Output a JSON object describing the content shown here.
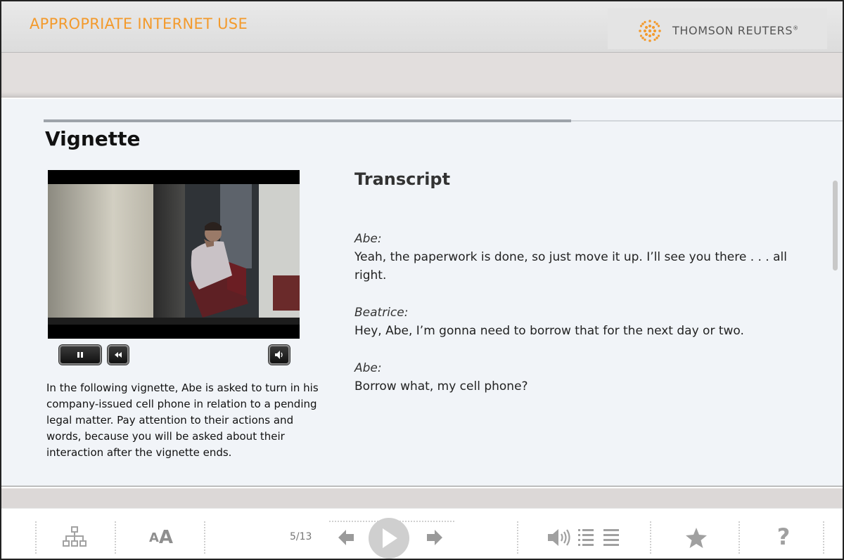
{
  "header": {
    "course_title": "APPROPRIATE INTERNET USE",
    "logo_text": "THOMSON REUTERS",
    "logo_mark": "®",
    "accent_color": "#f39a2c"
  },
  "progress": {
    "fraction": 0.66
  },
  "section": {
    "title": "Vignette"
  },
  "video": {
    "controls": {
      "pause_icon": "pause-icon",
      "rewind_icon": "rewind-icon",
      "volume_icon": "volume-icon"
    }
  },
  "description": "In the following vignette, Abe is asked to turn in his company-issued cell phone in relation to a pending legal matter. Pay attention to their actions and words, because you will be asked about their interaction after the vignette ends.",
  "transcript": {
    "title": "Transcript",
    "lines": [
      {
        "speaker": "Abe:",
        "text": "Yeah, the paperwork is done, so just move it up. I’ll see you there . . . all right."
      },
      {
        "speaker": "Beatrice:",
        "text": "Hey, Abe, I’m gonna need to borrow that for the next day or two."
      },
      {
        "speaker": "Abe:",
        "text": "Borrow what, my cell phone?"
      }
    ]
  },
  "toolbar": {
    "page_counter": "5/13",
    "icons": [
      "sitemap-icon",
      "font-size-icon",
      "prev-arrow-icon",
      "play-icon",
      "next-arrow-icon",
      "audio-icon",
      "transcript-list-icon",
      "menu-list-icon",
      "bookmark-star-icon",
      "help-icon"
    ],
    "font_size_label": "AA",
    "help_label": "?"
  }
}
